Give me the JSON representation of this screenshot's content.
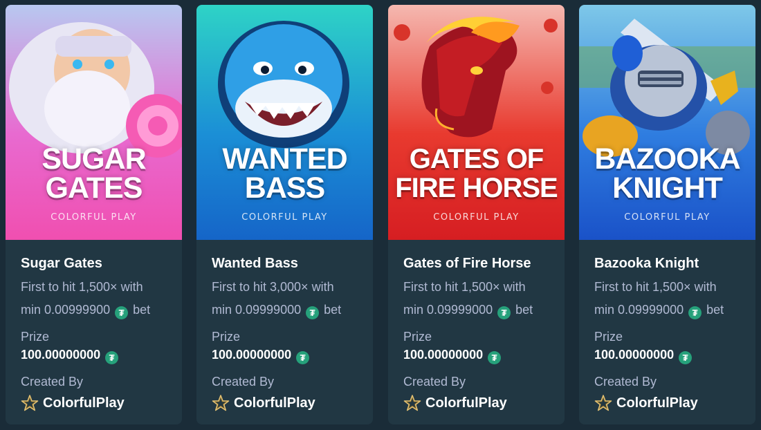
{
  "cards": [
    {
      "banner_line1": "SUGAR",
      "banner_line2": "GATES",
      "provider_logo": "COLORFUL PLAY",
      "name": "Sugar Gates",
      "desc_line1": "First to hit 1,500× with",
      "desc_min_prefix": "min 0.00999900",
      "desc_bet": "bet",
      "prize_label": "Prize",
      "prize_value": "100.00000000",
      "created_by_label": "Created By",
      "creator": "ColorfulPlay",
      "currency_icon": "tether-coin-icon",
      "colors": {
        "top": "#b8c8f0",
        "mid": "#e86ad0",
        "bottom": "#f04fb0"
      }
    },
    {
      "banner_line1": "WANTED",
      "banner_line2": "BASS",
      "provider_logo": "COLORFUL PLAY",
      "name": "Wanted Bass",
      "desc_line1": "First to hit 3,000× with",
      "desc_min_prefix": "min 0.09999000",
      "desc_bet": "bet",
      "prize_label": "Prize",
      "prize_value": "100.00000000",
      "created_by_label": "Created By",
      "creator": "ColorfulPlay",
      "currency_icon": "tether-coin-icon",
      "colors": {
        "top": "#2ed3c6",
        "mid": "#1b8fd6",
        "bottom": "#1565c8"
      }
    },
    {
      "banner_line1": "GATES OF",
      "banner_line2": "FIRE HORSE",
      "provider_logo": "COLORFUL PLAY",
      "name": "Gates of Fire Horse",
      "desc_line1": "First to hit 1,500× with",
      "desc_min_prefix": "min 0.09999000",
      "desc_bet": "bet",
      "prize_label": "Prize",
      "prize_value": "100.00000000",
      "created_by_label": "Created By",
      "creator": "ColorfulPlay",
      "currency_icon": "tether-coin-icon",
      "colors": {
        "top": "#f5b8b0",
        "mid": "#e83a2f",
        "bottom": "#d61e22"
      }
    },
    {
      "banner_line1": "BAZOOKA",
      "banner_line2": "KNIGHT",
      "provider_logo": "COLORFUL PLAY",
      "name": "Bazooka Knight",
      "desc_line1": "First to hit 1,500× with",
      "desc_min_prefix": "min 0.09999000",
      "desc_bet": "bet",
      "prize_label": "Prize",
      "prize_value": "100.00000000",
      "created_by_label": "Created By",
      "creator": "ColorfulPlay",
      "currency_icon": "tether-coin-icon",
      "colors": {
        "top": "#7ec8e8",
        "mid": "#2f7de0",
        "bottom": "#1a52c8"
      }
    }
  ],
  "coin_symbol": "₮"
}
